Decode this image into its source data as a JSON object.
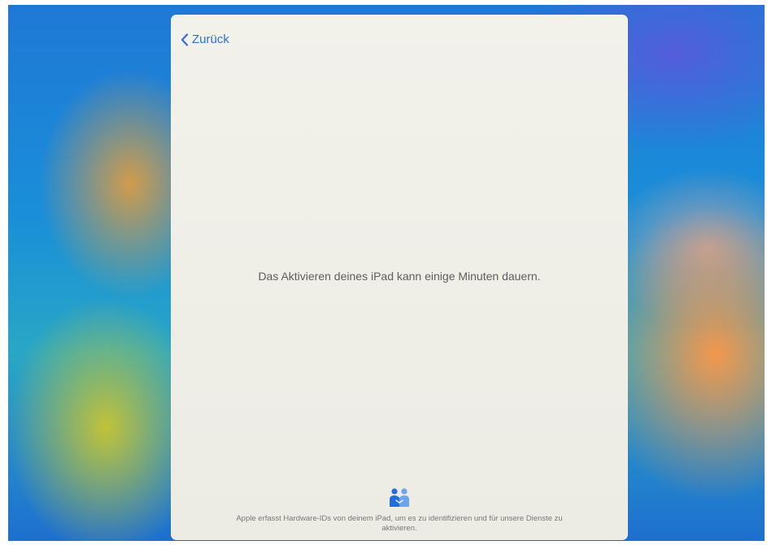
{
  "navigation": {
    "back_label": "Zurück"
  },
  "main": {
    "message": "Das Aktivieren deines iPad kann einige Minuten dauern."
  },
  "footer": {
    "privacy_icon": "handshake-people-icon",
    "privacy_text": "Apple erfasst Hardware-IDs von deinem iPad, um es zu identifizieren und für unsere Dienste zu aktivieren."
  },
  "colors": {
    "accent": "#2f6fe0",
    "card_background": "#efeee7",
    "text_primary": "#5e5e60",
    "text_secondary": "#77777a"
  }
}
